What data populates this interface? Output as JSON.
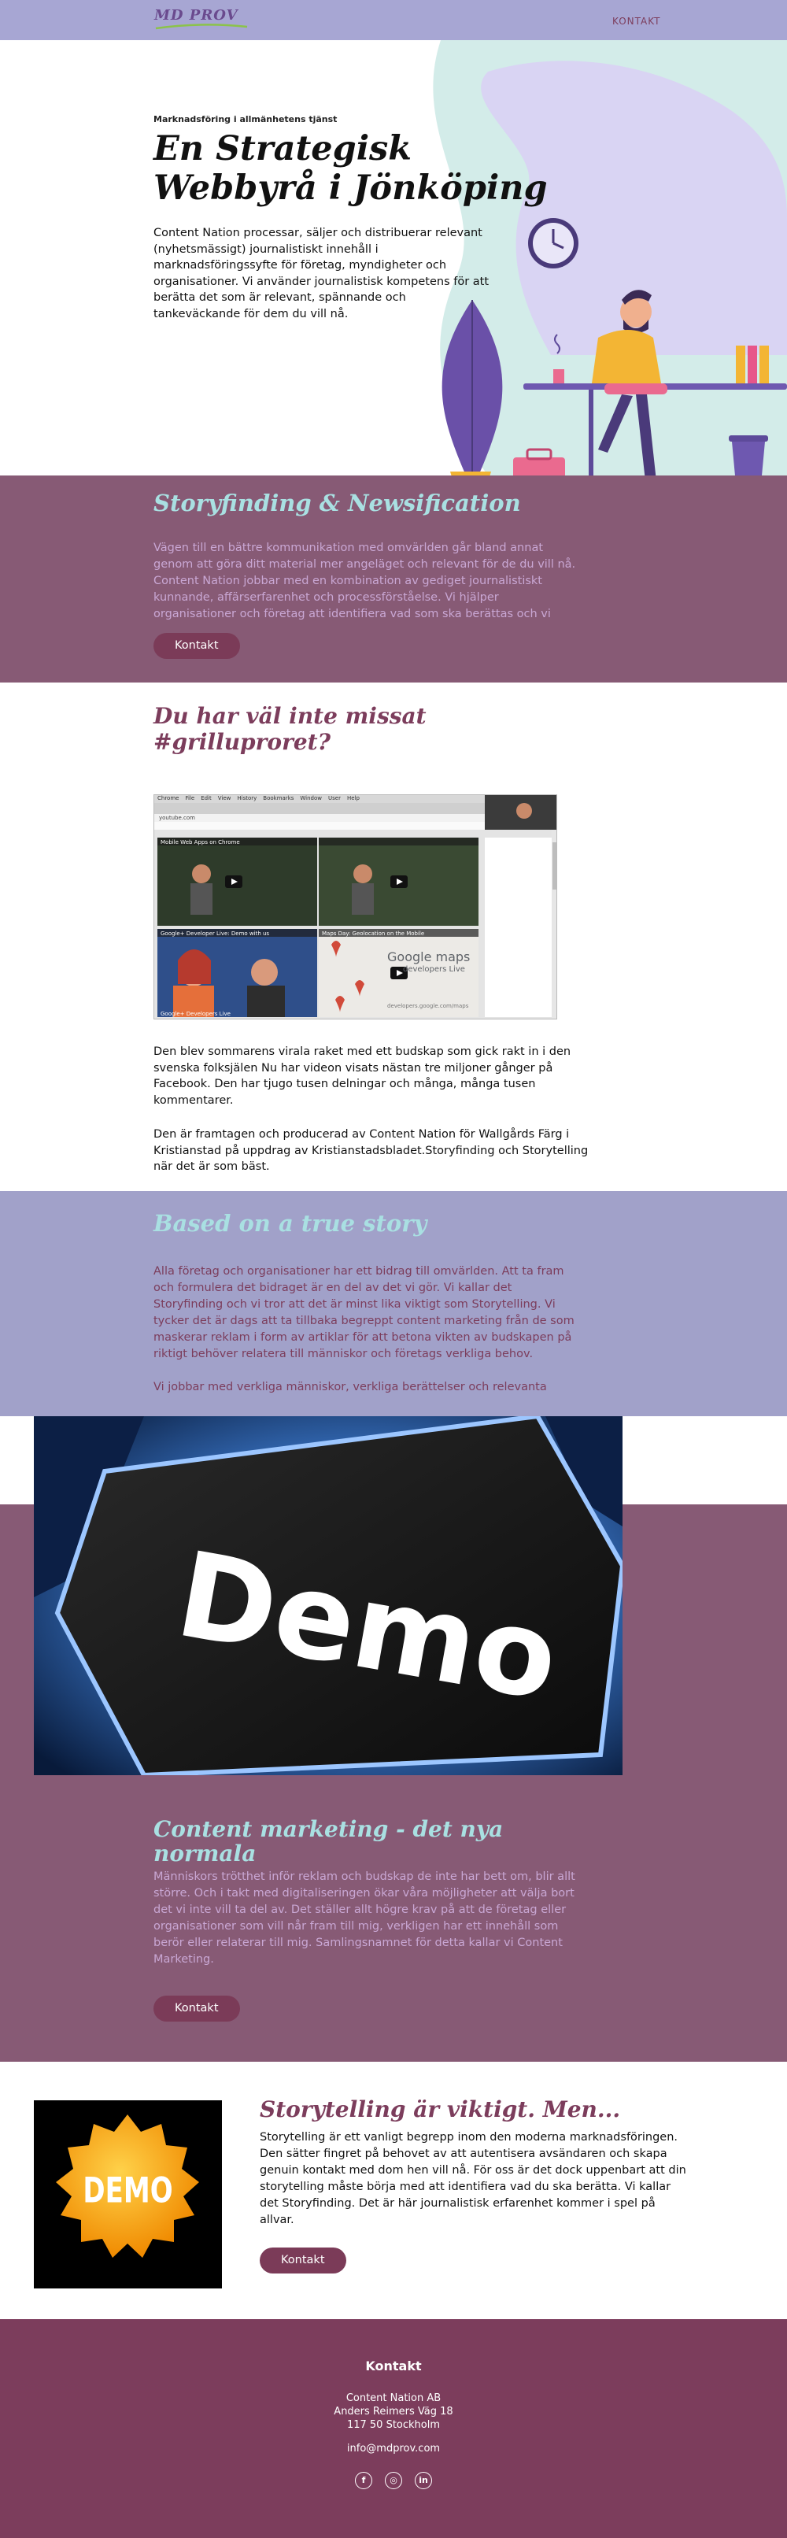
{
  "nav": {
    "logo": "MD PROV",
    "contact_link": "KONTAKT"
  },
  "hero": {
    "eyebrow": "Marknadsföring i allmänhetens tjänst",
    "title": "En Strategisk Webbyrå i Jönköping",
    "text": "Content Nation processar, säljer och distribuerar relevant (nyhetsmässigt) journalistiskt innehåll i marknadsföringssyfte för företag, myndigheter och organisationer. Vi använder journalistisk kompetens för att berätta det som är relevant, spännande och tankeväckande för dem du vill nå."
  },
  "storyfinding": {
    "heading": "Storyfinding & Newsification",
    "text": "Vägen till en bättre kommunikation med omvärlden går bland annat genom att göra ditt material mer angeläget och relevant för de du vill nå. Content Nation jobbar med en kombination av gediget journalistiskt kunnande, affärserfarenhet och processförståelse. Vi hjälper organisationer och företag att identifiera vad som ska berättas och vi",
    "button": "Kontakt"
  },
  "grill": {
    "heading": "Du har väl inte missat #grilluproret?",
    "p1": "Den blev sommarens virala raket med ett budskap som gick rakt in i den svenska folksjälen Nu har videon visats nästan tre miljoner gånger på Facebook. Den har tjugo tusen delningar och många, många tusen kommentarer.",
    "p2": "Den är framtagen och producerad av Content Nation för Wallgårds Färg i Kristianstad på uppdrag av Kristianstadsbladet.Storyfinding och Storytelling när det är som bäst.",
    "screenshot": {
      "menu": [
        "Chrome",
        "File",
        "Edit",
        "View",
        "History",
        "Bookmarks",
        "Window",
        "User",
        "Help"
      ],
      "address": "youtube.com",
      "tiles": [
        {
          "caption": "Mobile Web Apps on Chrome"
        },
        {
          "caption": ""
        },
        {
          "caption": "Google+ Developer Live: Demo with us"
        },
        {
          "caption": "Maps Day: Geolocation on the Mobile"
        }
      ],
      "maps_title": "Google maps",
      "maps_sub": "developers Live",
      "maps_url": "developers.google.com/maps",
      "bottom_caption": "Google+ Developers Live"
    }
  },
  "truestory": {
    "heading": "Based on a true story",
    "p1": "Alla företag och organisationer har ett bidrag till omvärlden. Att ta fram och formulera det bidraget är en del av det vi gör. Vi kallar det Storyfinding och vi tror att det är minst lika viktigt som Storytelling. Vi tycker det är dags att ta tillbaka begreppt content marketing från de som maskerar reklam i form av artiklar för att betona vikten av budskapen på riktigt behöver relatera till människor och företags verkliga behov.",
    "p2": "Vi jobbar med verkliga människor, verkliga berättelser och relevanta"
  },
  "contentmarketing": {
    "image_word": "Demo",
    "heading": "Content marketing - det nya normala",
    "text": "Människors trötthet inför reklam och budskap de inte har bett om, blir allt större. Och i takt med digitaliseringen ökar våra möjligheter att välja bort det vi inte vill ta del av. Det ställer allt högre krav på att de företag eller organisationer som vill når fram till mig, verkligen har ett innehåll som berör eller relaterar till mig. Samlingsnamnet för detta kallar vi Content Marketing.",
    "button": "Kontakt"
  },
  "storytelling": {
    "badge": "DEMO",
    "heading": "Storytelling är viktigt. Men...",
    "text": "Storytelling är ett vanligt begrepp inom den moderna marknadsföringen. Den sätter fingret på behovet av att autentisera avsändaren och skapa genuin kontakt med dom hen vill nå. För oss är det dock uppenbart att din storytelling måste börja med att identifiera vad du ska berätta. Vi kallar det Storyfinding. Det är här journalistisk erfarenhet kommer i spel på allvar.",
    "button": "Kontakt"
  },
  "footer": {
    "heading": "Kontakt",
    "company": "Content Nation AB",
    "street": "Anders Reimers Väg 18",
    "city": "117 50 Stockholm",
    "email": "info@mdprov.com",
    "socials": [
      {
        "icon": "facebook-icon",
        "glyph": "f"
      },
      {
        "icon": "instagram-icon",
        "glyph": "◎"
      },
      {
        "icon": "linkedin-icon",
        "glyph": "in"
      }
    ]
  },
  "colors": {
    "nav_bg": "#a7a6d3",
    "plum": "#875a75",
    "deep_plum": "#7c3d5c",
    "mint": "#a9e0e2",
    "lavender_text": "#c9a7d4",
    "periwinkle": "#a1a1c9"
  }
}
